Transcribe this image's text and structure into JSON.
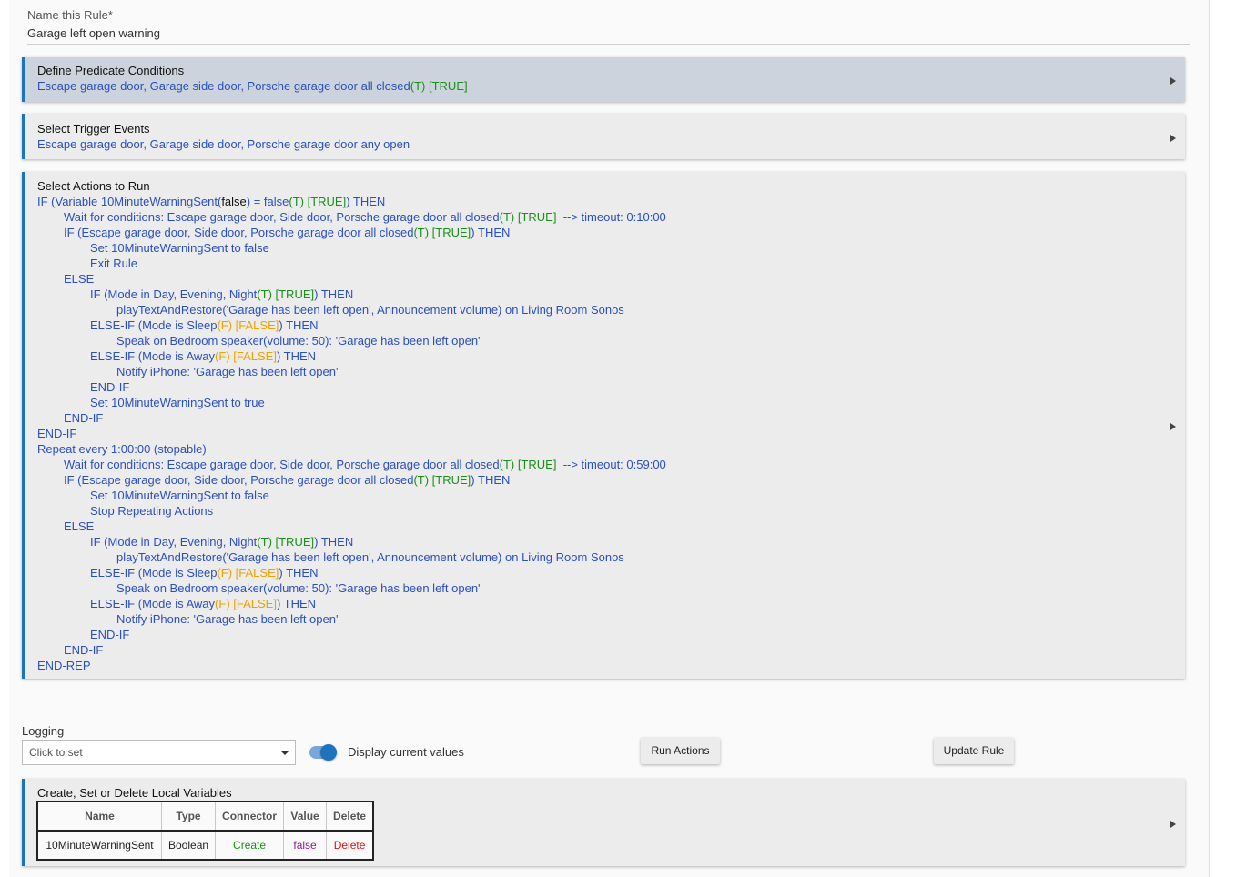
{
  "rule_name": {
    "label": "Name this Rule*",
    "value": "Garage left open warning"
  },
  "predicate": {
    "title": "Define Predicate Conditions",
    "text": "Escape garage door, Garage side door, Porsche garage door all closed",
    "state": "(T) [TRUE]"
  },
  "trigger": {
    "title": "Select Trigger Events",
    "text": "Escape garage door, Garage side door, Porsche garage door any open"
  },
  "actions": {
    "title": "Select Actions to Run",
    "lines": [
      {
        "indent": 0,
        "parts": [
          {
            "t": "IF (Variable 10MinuteWarningSent(",
            "c": "b"
          },
          {
            "t": "false",
            "c": "k"
          },
          {
            "t": ") = false",
            "c": "b"
          },
          {
            "t": "(T) [TRUE]",
            "c": "g"
          },
          {
            "t": ") THEN",
            "c": "b"
          }
        ]
      },
      {
        "indent": 1,
        "parts": [
          {
            "t": "Wait for conditions: Escape garage door, Side door, Porsche garage door all closed",
            "c": "b"
          },
          {
            "t": "(T) [TRUE]",
            "c": "g"
          },
          {
            "t": "  --> timeout: 0:10:00",
            "c": "b"
          }
        ]
      },
      {
        "indent": 1,
        "parts": [
          {
            "t": "IF (Escape garage door, Side door, Porsche garage door all closed",
            "c": "b"
          },
          {
            "t": "(T) [TRUE]",
            "c": "g"
          },
          {
            "t": ") THEN",
            "c": "b"
          }
        ]
      },
      {
        "indent": 2,
        "parts": [
          {
            "t": "Set 10MinuteWarningSent to false",
            "c": "b"
          }
        ]
      },
      {
        "indent": 2,
        "parts": [
          {
            "t": "Exit Rule",
            "c": "b"
          }
        ]
      },
      {
        "indent": 1,
        "parts": [
          {
            "t": "ELSE",
            "c": "b"
          }
        ]
      },
      {
        "indent": 2,
        "parts": [
          {
            "t": "IF (Mode in Day, Evening, Night",
            "c": "b"
          },
          {
            "t": "(T) [TRUE]",
            "c": "g"
          },
          {
            "t": ") THEN",
            "c": "b"
          }
        ]
      },
      {
        "indent": 3,
        "parts": [
          {
            "t": "playTextAndRestore('Garage has been left open', Announcement volume) on Living Room Sonos",
            "c": "b"
          }
        ]
      },
      {
        "indent": 2,
        "parts": [
          {
            "t": "ELSE-IF (Mode is Sleep",
            "c": "b"
          },
          {
            "t": "(F) [FALSE]",
            "c": "o"
          },
          {
            "t": ") THEN",
            "c": "b"
          }
        ]
      },
      {
        "indent": 3,
        "parts": [
          {
            "t": "Speak on Bedroom speaker(volume: 50): 'Garage has been left open'",
            "c": "b"
          }
        ]
      },
      {
        "indent": 2,
        "parts": [
          {
            "t": "ELSE-IF (Mode is Away",
            "c": "b"
          },
          {
            "t": "(F) [FALSE]",
            "c": "o"
          },
          {
            "t": ") THEN",
            "c": "b"
          }
        ]
      },
      {
        "indent": 3,
        "parts": [
          {
            "t": "Notify iPhone: 'Garage has been left open'",
            "c": "b"
          }
        ]
      },
      {
        "indent": 2,
        "parts": [
          {
            "t": "END-IF",
            "c": "b"
          }
        ]
      },
      {
        "indent": 2,
        "parts": [
          {
            "t": "Set 10MinuteWarningSent to true",
            "c": "b"
          }
        ]
      },
      {
        "indent": 1,
        "parts": [
          {
            "t": "END-IF",
            "c": "b"
          }
        ]
      },
      {
        "indent": 0,
        "parts": [
          {
            "t": "END-IF",
            "c": "b"
          }
        ]
      },
      {
        "indent": 0,
        "parts": [
          {
            "t": "Repeat every 1:00:00 (stopable)",
            "c": "b"
          }
        ]
      },
      {
        "indent": 1,
        "parts": [
          {
            "t": "Wait for conditions: Escape garage door, Side door, Porsche garage door all closed",
            "c": "b"
          },
          {
            "t": "(T) [TRUE]",
            "c": "g"
          },
          {
            "t": "  --> timeout: 0:59:00",
            "c": "b"
          }
        ]
      },
      {
        "indent": 1,
        "parts": [
          {
            "t": "IF (Escape garage door, Side door, Porsche garage door all closed",
            "c": "b"
          },
          {
            "t": "(T) [TRUE]",
            "c": "g"
          },
          {
            "t": ") THEN",
            "c": "b"
          }
        ]
      },
      {
        "indent": 2,
        "parts": [
          {
            "t": "Set 10MinuteWarningSent to false",
            "c": "b"
          }
        ]
      },
      {
        "indent": 2,
        "parts": [
          {
            "t": "Stop Repeating Actions",
            "c": "b"
          }
        ]
      },
      {
        "indent": 1,
        "parts": [
          {
            "t": "ELSE",
            "c": "b"
          }
        ]
      },
      {
        "indent": 2,
        "parts": [
          {
            "t": "IF (Mode in Day, Evening, Night",
            "c": "b"
          },
          {
            "t": "(T) [TRUE]",
            "c": "g"
          },
          {
            "t": ") THEN",
            "c": "b"
          }
        ]
      },
      {
        "indent": 3,
        "parts": [
          {
            "t": "playTextAndRestore('Garage has been left open', Announcement volume) on Living Room Sonos",
            "c": "b"
          }
        ]
      },
      {
        "indent": 2,
        "parts": [
          {
            "t": "ELSE-IF (Mode is Sleep",
            "c": "b"
          },
          {
            "t": "(F) [FALSE]",
            "c": "o"
          },
          {
            "t": ") THEN",
            "c": "b"
          }
        ]
      },
      {
        "indent": 3,
        "parts": [
          {
            "t": "Speak on Bedroom speaker(volume: 50): 'Garage has been left open'",
            "c": "b"
          }
        ]
      },
      {
        "indent": 2,
        "parts": [
          {
            "t": "ELSE-IF (Mode is Away",
            "c": "b"
          },
          {
            "t": "(F) [FALSE]",
            "c": "o"
          },
          {
            "t": ") THEN",
            "c": "b"
          }
        ]
      },
      {
        "indent": 3,
        "parts": [
          {
            "t": "Notify iPhone: 'Garage has been left open'",
            "c": "b"
          }
        ]
      },
      {
        "indent": 2,
        "parts": [
          {
            "t": "END-IF",
            "c": "b"
          }
        ]
      },
      {
        "indent": 1,
        "parts": [
          {
            "t": "END-IF",
            "c": "b"
          }
        ]
      },
      {
        "indent": 0,
        "parts": [
          {
            "t": "END-REP",
            "c": "b"
          }
        ]
      }
    ]
  },
  "logging": {
    "label": "Logging",
    "select_value": "Click to set"
  },
  "display_toggle": {
    "label": "Display current values",
    "on": true
  },
  "buttons": {
    "run_actions": "Run Actions",
    "update_rule": "Update Rule"
  },
  "local_vars": {
    "title": "Create, Set or Delete Local Variables",
    "columns": [
      "Name",
      "Type",
      "Connector",
      "Value",
      "Delete"
    ],
    "rows": [
      {
        "name": "10MinuteWarningSent",
        "type": "Boolean",
        "connector": "Create",
        "value": "false",
        "delete": "Delete"
      }
    ]
  },
  "colors": {
    "accent": "#1e73be",
    "text_blue": "#2a4fc1",
    "true_green": "#1a8f1a",
    "false_orange": "#f0a000"
  },
  "icons": {
    "panel_expand": "triangle-right-icon",
    "select_caret": "caret-down-icon"
  }
}
